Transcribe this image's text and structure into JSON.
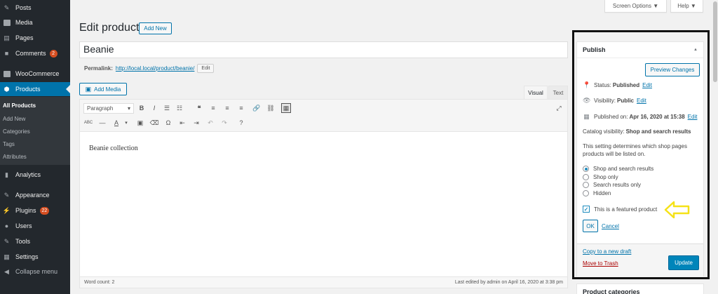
{
  "sidebar": {
    "items": [
      {
        "label": "Posts",
        "icon": "pushpin-icon"
      },
      {
        "label": "Media",
        "icon": "media-icon"
      },
      {
        "label": "Pages",
        "icon": "pages-icon"
      },
      {
        "label": "Comments",
        "icon": "comments-icon",
        "badge": "2"
      },
      {
        "label": "WooCommerce",
        "icon": "woocommerce-icon"
      },
      {
        "label": "Products",
        "icon": "products-icon"
      },
      {
        "label": "Analytics",
        "icon": "analytics-icon"
      },
      {
        "label": "Appearance",
        "icon": "appearance-icon"
      },
      {
        "label": "Plugins",
        "icon": "plugins-icon",
        "badge": "22"
      },
      {
        "label": "Users",
        "icon": "users-icon"
      },
      {
        "label": "Tools",
        "icon": "tools-icon"
      },
      {
        "label": "Settings",
        "icon": "settings-icon"
      },
      {
        "label": "Collapse menu",
        "icon": "collapse-icon"
      }
    ],
    "submenu": [
      "All Products",
      "Add New",
      "Categories",
      "Tags",
      "Attributes"
    ]
  },
  "top": {
    "screen_options": "Screen Options ▼",
    "help": "Help ▼"
  },
  "header": {
    "title": "Edit product",
    "add_new": "Add New"
  },
  "product": {
    "title_value": "Beanie",
    "permalink_label": "Permalink:",
    "permalink_url": "http://local.local/product/beanie/",
    "permalink_edit": "Edit"
  },
  "editor": {
    "add_media": "Add Media",
    "tab_visual": "Visual",
    "tab_text": "Text",
    "format_select": "Paragraph",
    "content": "Beanie collection",
    "word_count": "Word count: 2",
    "last_edited": "Last edited by admin on April 16, 2020 at 3:38 pm"
  },
  "publish": {
    "heading": "Publish",
    "preview": "Preview Changes",
    "status_label": "Status:",
    "status_value": "Published",
    "visibility_label": "Visibility:",
    "visibility_value": "Public",
    "published_label": "Published on:",
    "published_value": "Apr 16, 2020 at 15:38",
    "edit": "Edit",
    "catalog_label": "Catalog visibility:",
    "catalog_value": "Shop and search results",
    "catalog_help": "This setting determines which shop pages products will be listed on.",
    "options": [
      {
        "label": "Shop and search results",
        "selected": true
      },
      {
        "label": "Shop only",
        "selected": false
      },
      {
        "label": "Search results only",
        "selected": false
      },
      {
        "label": "Hidden",
        "selected": false
      }
    ],
    "featured_label": "This is a featured product",
    "featured_checked": true,
    "ok": "OK",
    "cancel": "Cancel",
    "copy_draft": "Copy to a new draft",
    "trash": "Move to Trash",
    "update": "Update"
  },
  "categories_box": {
    "heading": "Product categories"
  },
  "colors": {
    "accent": "#0073aa",
    "sidebar": "#23282d",
    "highlight_arrow": "#f5e218"
  }
}
